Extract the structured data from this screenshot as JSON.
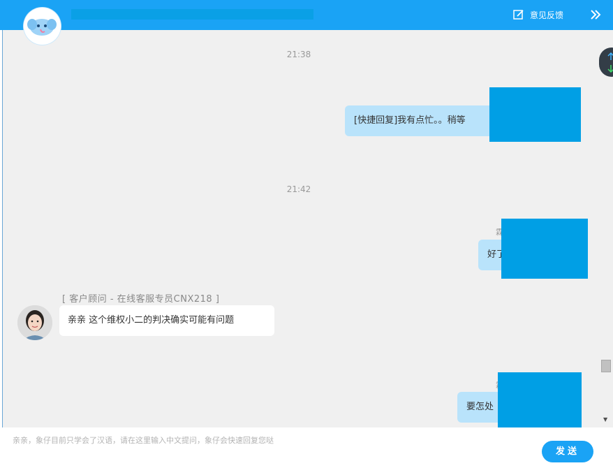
{
  "header": {
    "feedback_label": "意见反馈",
    "logo_icon": "elephant-mascot-icon",
    "feedback_icon": "edit-icon",
    "collapse_icon": "double-chevron-right-icon",
    "accent": "#1aa3f5"
  },
  "chat": {
    "time_1": "21:38",
    "msg_1": "[快捷回复]我有点忙。。稍等",
    "time_2": "21:42",
    "msg_2_name": "霖",
    "msg_2": "好了",
    "agent_label": "[ 客户顾问  -  在线客服专员CNX218 ]",
    "agent_msg": "亲亲 这个维权小二的判决确实可能有问题",
    "msg_3_name": "霖",
    "msg_3": "要怎处"
  },
  "input": {
    "placeholder": "亲亲，象仔目前只学会了汉语，请在这里输入中文提问，象仔会快速回复您哒",
    "send_label": "发送"
  },
  "float_button": {
    "up_icon": "arrow-up-icon",
    "down_icon": "arrow-down-icon"
  }
}
